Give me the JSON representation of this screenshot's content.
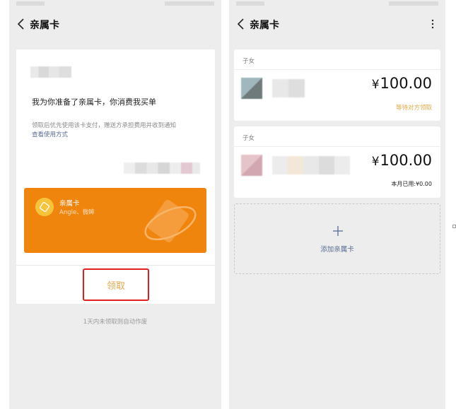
{
  "left_screen": {
    "title": "亲属卡",
    "invite_message": "我为你准备了亲属卡，你消费我买单",
    "note": "领取后优先使用该卡支付，赠送方承担费用并收到通知",
    "view_usage_link": "查看使用方式",
    "card": {
      "name": "亲属卡",
      "subtitle": "Angle、微眸"
    },
    "claim_button": "领取",
    "expiry_note": "1天内未领取则自动作废"
  },
  "right_screen": {
    "title": "亲属卡",
    "cards": [
      {
        "relation": "子女",
        "currency": "¥",
        "amount": "100.00",
        "status": "等待对方领取"
      },
      {
        "relation": "子女",
        "currency": "¥",
        "amount": "100.00",
        "used": "本月已用:¥0.00"
      }
    ],
    "add_card_label": "添加亲属卡"
  },
  "colors": {
    "card_orange": "#f0850e",
    "accent_gold": "#e3a84a",
    "link_blue": "#586c94",
    "highlight_red": "#e21e1e"
  },
  "icons": [
    "back-icon",
    "more-icon",
    "family-card-logo-icon",
    "plus-icon"
  ]
}
